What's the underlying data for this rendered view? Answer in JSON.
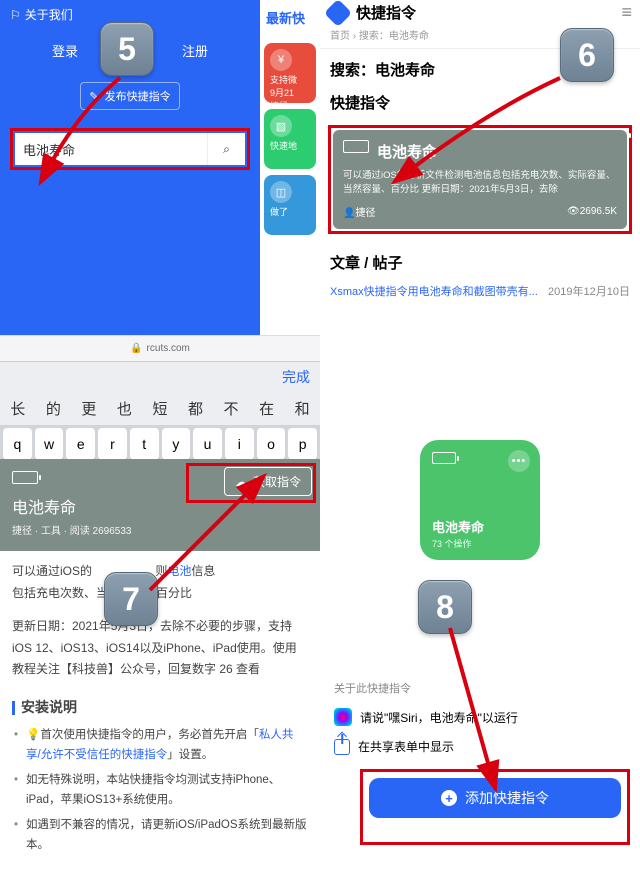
{
  "steps": {
    "s5": "5",
    "s6": "6",
    "s7": "7",
    "s8": "8"
  },
  "panel5": {
    "about": "关于我们",
    "login": "登录",
    "register": "注册",
    "publish": "发布快捷指令",
    "search_value": "电池寿命",
    "side_title": "最新快",
    "chip1_l1": "支持微",
    "chip1_l2": "9月21",
    "chip1_l3": "捷径",
    "chip2_l1": "快速地",
    "chip3_l1": "做了"
  },
  "urlbar": {
    "host": "rcuts.com"
  },
  "keyboard": {
    "done": "完成",
    "cn": [
      "长",
      "的",
      "更",
      "也",
      "短",
      "都",
      "不",
      "在",
      "和"
    ],
    "row": [
      "q",
      "w",
      "e",
      "r",
      "t",
      "y",
      "u",
      "i",
      "o",
      "p"
    ]
  },
  "panel7": {
    "get": "获取指令",
    "title": "电池寿命",
    "meta": "捷径 · 工具 · 阅读 2696533",
    "body1a": "可以通过iOS的",
    "body1b": "则",
    "body1c": "电池",
    "body1d": "信息",
    "body2": "包括充电次数、当然容量、百分比",
    "body3": "更新日期：2021年5月3日，去除不必要的步骤，支持iOS 12、iOS13、iOS14以及iPhone、iPad使用。使用教程关注【科技兽】公众号，回复数字 26 查看",
    "install_h": "安装说明",
    "li1a": "💡首次使用快捷指令的用户，务必首先开启「",
    "li1b": "私人共享/允许不受信任的快捷指令",
    "li1c": "」设置。",
    "li2": "如无特殊说明，本站快捷指令均测试支持iPhone、iPad，苹果iOS13+系统使用。",
    "li3": "如遇到不兼容的情况，请更新iOS/iPadOS系统到最新版本。"
  },
  "panel6": {
    "app_title": "快捷指令",
    "crumb": "首页 › 搜索：电池寿命",
    "search_label": "搜索：电池寿命",
    "section": "快捷指令",
    "res_title": "电池寿命",
    "res_desc": "可以通过iOS的分析文件检测电池信息包括充电次数、实际容量、当然容量、百分比 更新日期：2021年5月3日，去除",
    "res_src": "捷径",
    "res_views": "2696.5K",
    "articles_h": "文章 / 帖子",
    "art_title": "Xsmax快捷指令用电池寿命和截图带壳有...",
    "art_date": "2019年12月10日"
  },
  "panel8": {
    "card_title": "电池寿命",
    "card_sub": "73 个操作",
    "about": "关于此快捷指令",
    "siri_text": "请说\"嘿Siri，电池寿命\"以运行",
    "share_text": "在共享表单中显示",
    "add": "添加快捷指令"
  }
}
